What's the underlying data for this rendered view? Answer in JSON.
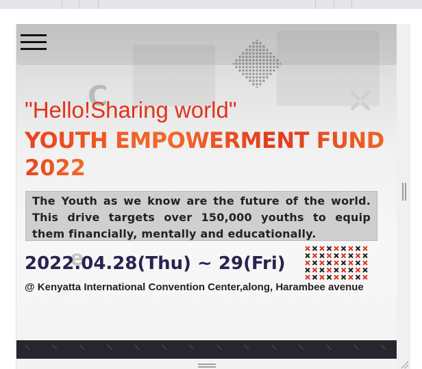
{
  "hero": {
    "tagline": "\"Hello!Sharing world\"",
    "title": "YOUTH EMPOWERMENT FUND",
    "year": "2022",
    "description": "The Youth as we know are the future of the world. This drive targets over 150,000 youths to equip them financially, mentally and educationally.",
    "date": "2022.04.28(Thu) ~ 29(Fri)",
    "venue": "@ Kenyatta International Convention Center,along, Harambee avenue"
  },
  "icons": {
    "menu": "hamburger-menu-icon",
    "close": "x-mark-icon"
  },
  "colors": {
    "accent": "#e2321c",
    "title_gradient_start": "#e8431f",
    "title_gradient_end": "#f06428",
    "date_text": "#2a2250",
    "dark_band": "#26262e"
  }
}
